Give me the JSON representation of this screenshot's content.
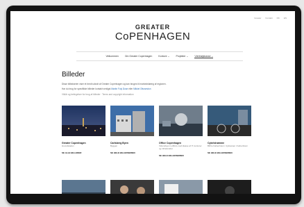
{
  "utility_links": [
    "Greater",
    "Kontakt",
    "DK",
    "EN"
  ],
  "logo": {
    "line1": "GREATER",
    "line2": "CoPENHAGEN"
  },
  "nav": [
    {
      "label": "Velkommen"
    },
    {
      "label": "Om Greater Copenhagen"
    },
    {
      "label": "Kontore ⌄"
    },
    {
      "label": "Projekter ⌄"
    },
    {
      "label": "Værktøjskasse ⌄",
      "active": true
    }
  ],
  "page_title": "Billeder",
  "intro": {
    "line1": "Disse billedserier viser et bredt udsnit af Greater Copenhagen og kan bruges til markedsføring af regionen.",
    "line2_prefix": "Har du brug for specifikke billeder kontakt venligst",
    "line2_link1": "Martin Fuly Duse",
    "line2_mid": "eller",
    "line2_link2": "Mikkel Ottoseston",
    "line3": "Vilkår og betingelser for brug af billeder · Terms and copyright information"
  },
  "cards": [
    {
      "title": "Greater Copenhagen",
      "subtitle": "Hovedstaden",
      "link": "SE ALLE BILLEDER"
    },
    {
      "title": "Carlsberg Byen",
      "subtitle": "Byggen",
      "link": "SE HELE BILLEDSERIEN"
    },
    {
      "title": "Office Copenhagen",
      "subtitle": "Vidensbyen Luftfoto med klasse af IT, kontorer og infrastruktur",
      "link": "SE HELE BILLEDSERIEN"
    },
    {
      "title": "Cykelstrømme",
      "subtitle": "Bilfrie København i Cyklestuer i København",
      "link": "SE HELE BILLEDSERIEN"
    }
  ]
}
